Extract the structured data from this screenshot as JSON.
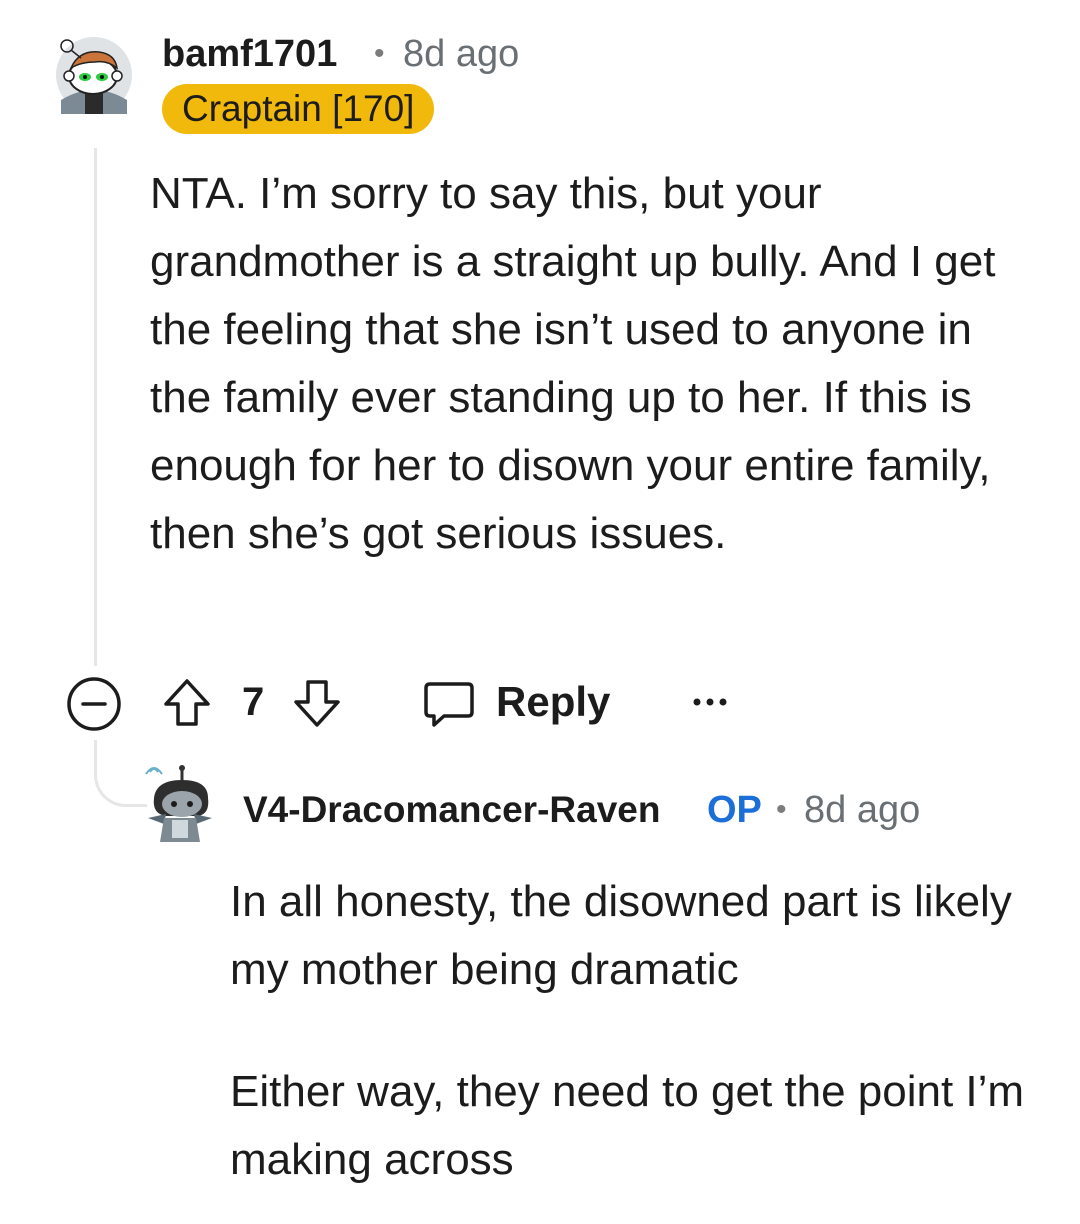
{
  "comment": {
    "username": "bamf1701",
    "separator": "•",
    "time": "8d ago",
    "flair": "Craptain [170]",
    "body": "NTA. I’m sorry to say this, but your grandmother is a straight up bully. And I get the feeling that she isn’t used to anyone in the family ever standing up to her. If this is enough for her to disown your entire family, then she’s got serious issues.",
    "vote_count": "7",
    "reply_label": "Reply",
    "more_label": "•••"
  },
  "reply": {
    "username": "V4-Dracomancer-Raven",
    "op_label": "OP",
    "separator": "•",
    "time": "8d ago",
    "paragraph1": "In all honesty, the disowned part is likely my mother being dramatic",
    "paragraph2": "Either way, they need to get the point I’m making across"
  },
  "colors": {
    "flair_bg": "#f0b90b",
    "op_blue": "#1c6ed8",
    "thread_line": "#e6e6e6",
    "meta_gray": "#6a6f73"
  }
}
